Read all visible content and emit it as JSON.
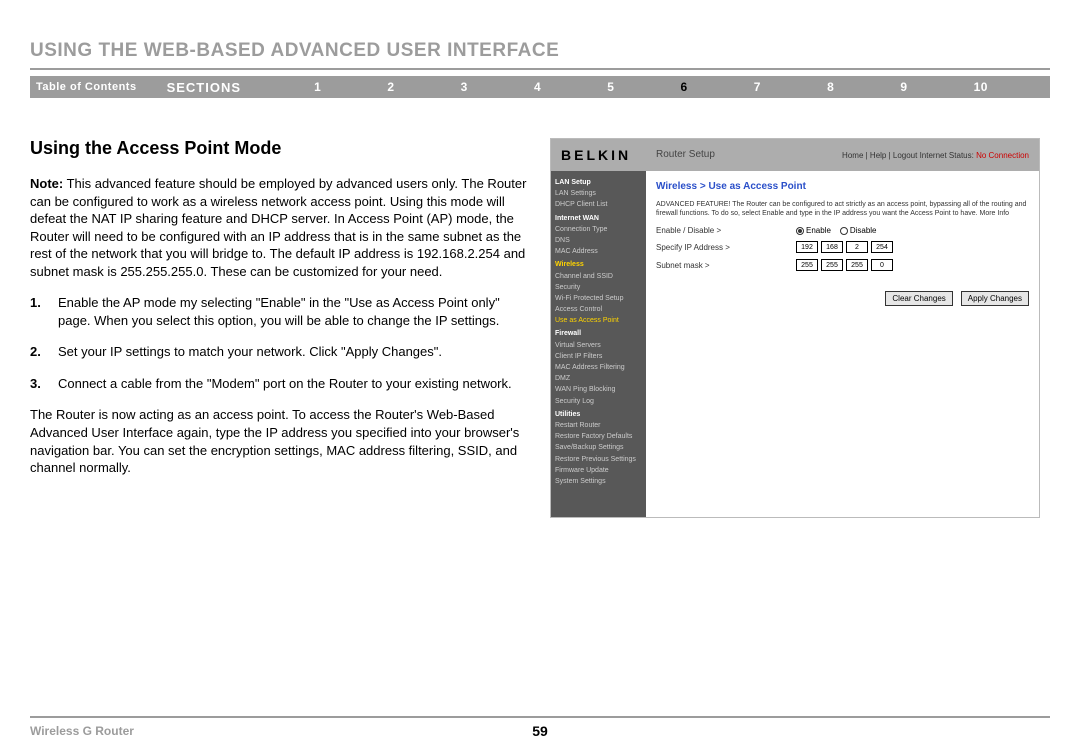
{
  "header": {
    "title": "USING THE WEB-BASED ADVANCED USER INTERFACE"
  },
  "nav": {
    "toc": "Table of Contents",
    "sections_label": "SECTIONS",
    "items": [
      "1",
      "2",
      "3",
      "4",
      "5",
      "6",
      "7",
      "8",
      "9",
      "10"
    ],
    "active": "6"
  },
  "content": {
    "heading": "Using the Access Point Mode",
    "note_label": "Note:",
    "note_text": " This advanced feature should be employed by advanced users only. The Router can be configured to work as a wireless network access point. Using this mode will defeat the NAT IP sharing feature and DHCP server. In Access Point (AP) mode, the Router will need to be configured with an IP address that is in the same subnet as the rest of the network that you will bridge to. The default IP address is 192.168.2.254 and subnet mask is 255.255.255.0. These can be customized for your need.",
    "steps": [
      "Enable the AP mode my selecting \"Enable\" in the \"Use as Access Point only\" page. When you select this option, you will be able to change the IP settings.",
      "Set your IP settings to match your network. Click \"Apply Changes\".",
      "Connect a cable from the \"Modem\" port on the Router to your existing network."
    ],
    "after": "The Router is now acting as an access point. To access the Router's Web-Based Advanced User Interface again, type the IP address you specified into your browser's navigation bar. You can set the encryption settings, MAC address filtering, SSID, and channel normally."
  },
  "router_shot": {
    "logo": "BELKIN",
    "header_title": "Router Setup",
    "header_links_left": "Home | Help | Logout   Internet Status:",
    "header_links_status": "No Connection",
    "breadcrumb": "Wireless > Use as Access Point",
    "blurb": "ADVANCED FEATURE! The Router can be configured to act strictly as an access point, bypassing all of the routing and firewall functions. To do so, select Enable and type in the IP address you want the Access Point to have. More Info",
    "row_enable_label": "Enable / Disable >",
    "row_enable_opt1": "Enable",
    "row_enable_opt2": "Disable",
    "row_ip_label": "Specify IP Address >",
    "row_ip": [
      "192",
      "168",
      "2",
      "254"
    ],
    "row_mask_label": "Subnet mask >",
    "row_mask": [
      "255",
      "255",
      "255",
      "0"
    ],
    "btn_clear": "Clear Changes",
    "btn_apply": "Apply Changes",
    "sidebar": {
      "g1_hd": "LAN Setup",
      "g1": [
        "LAN Settings",
        "DHCP Client List"
      ],
      "g2_hd": "Internet WAN",
      "g2": [
        "Connection Type",
        "DNS",
        "MAC Address"
      ],
      "g3_hd": "Wireless",
      "g3": [
        "Channel and SSID",
        "Security",
        "Wi-Fi Protected Setup",
        "Access Control",
        "Use as Access Point"
      ],
      "g4_hd": "Firewall",
      "g4": [
        "Virtual Servers",
        "Client IP Filters",
        "MAC Address Filtering",
        "DMZ",
        "WAN Ping Blocking",
        "Security Log"
      ],
      "g5_hd": "Utilities",
      "g5": [
        "Restart Router",
        "Restore Factory Defaults",
        "Save/Backup Settings",
        "Restore Previous Settings",
        "Firmware Update",
        "System Settings"
      ]
    }
  },
  "footer": {
    "product": "Wireless G Router",
    "page": "59"
  }
}
